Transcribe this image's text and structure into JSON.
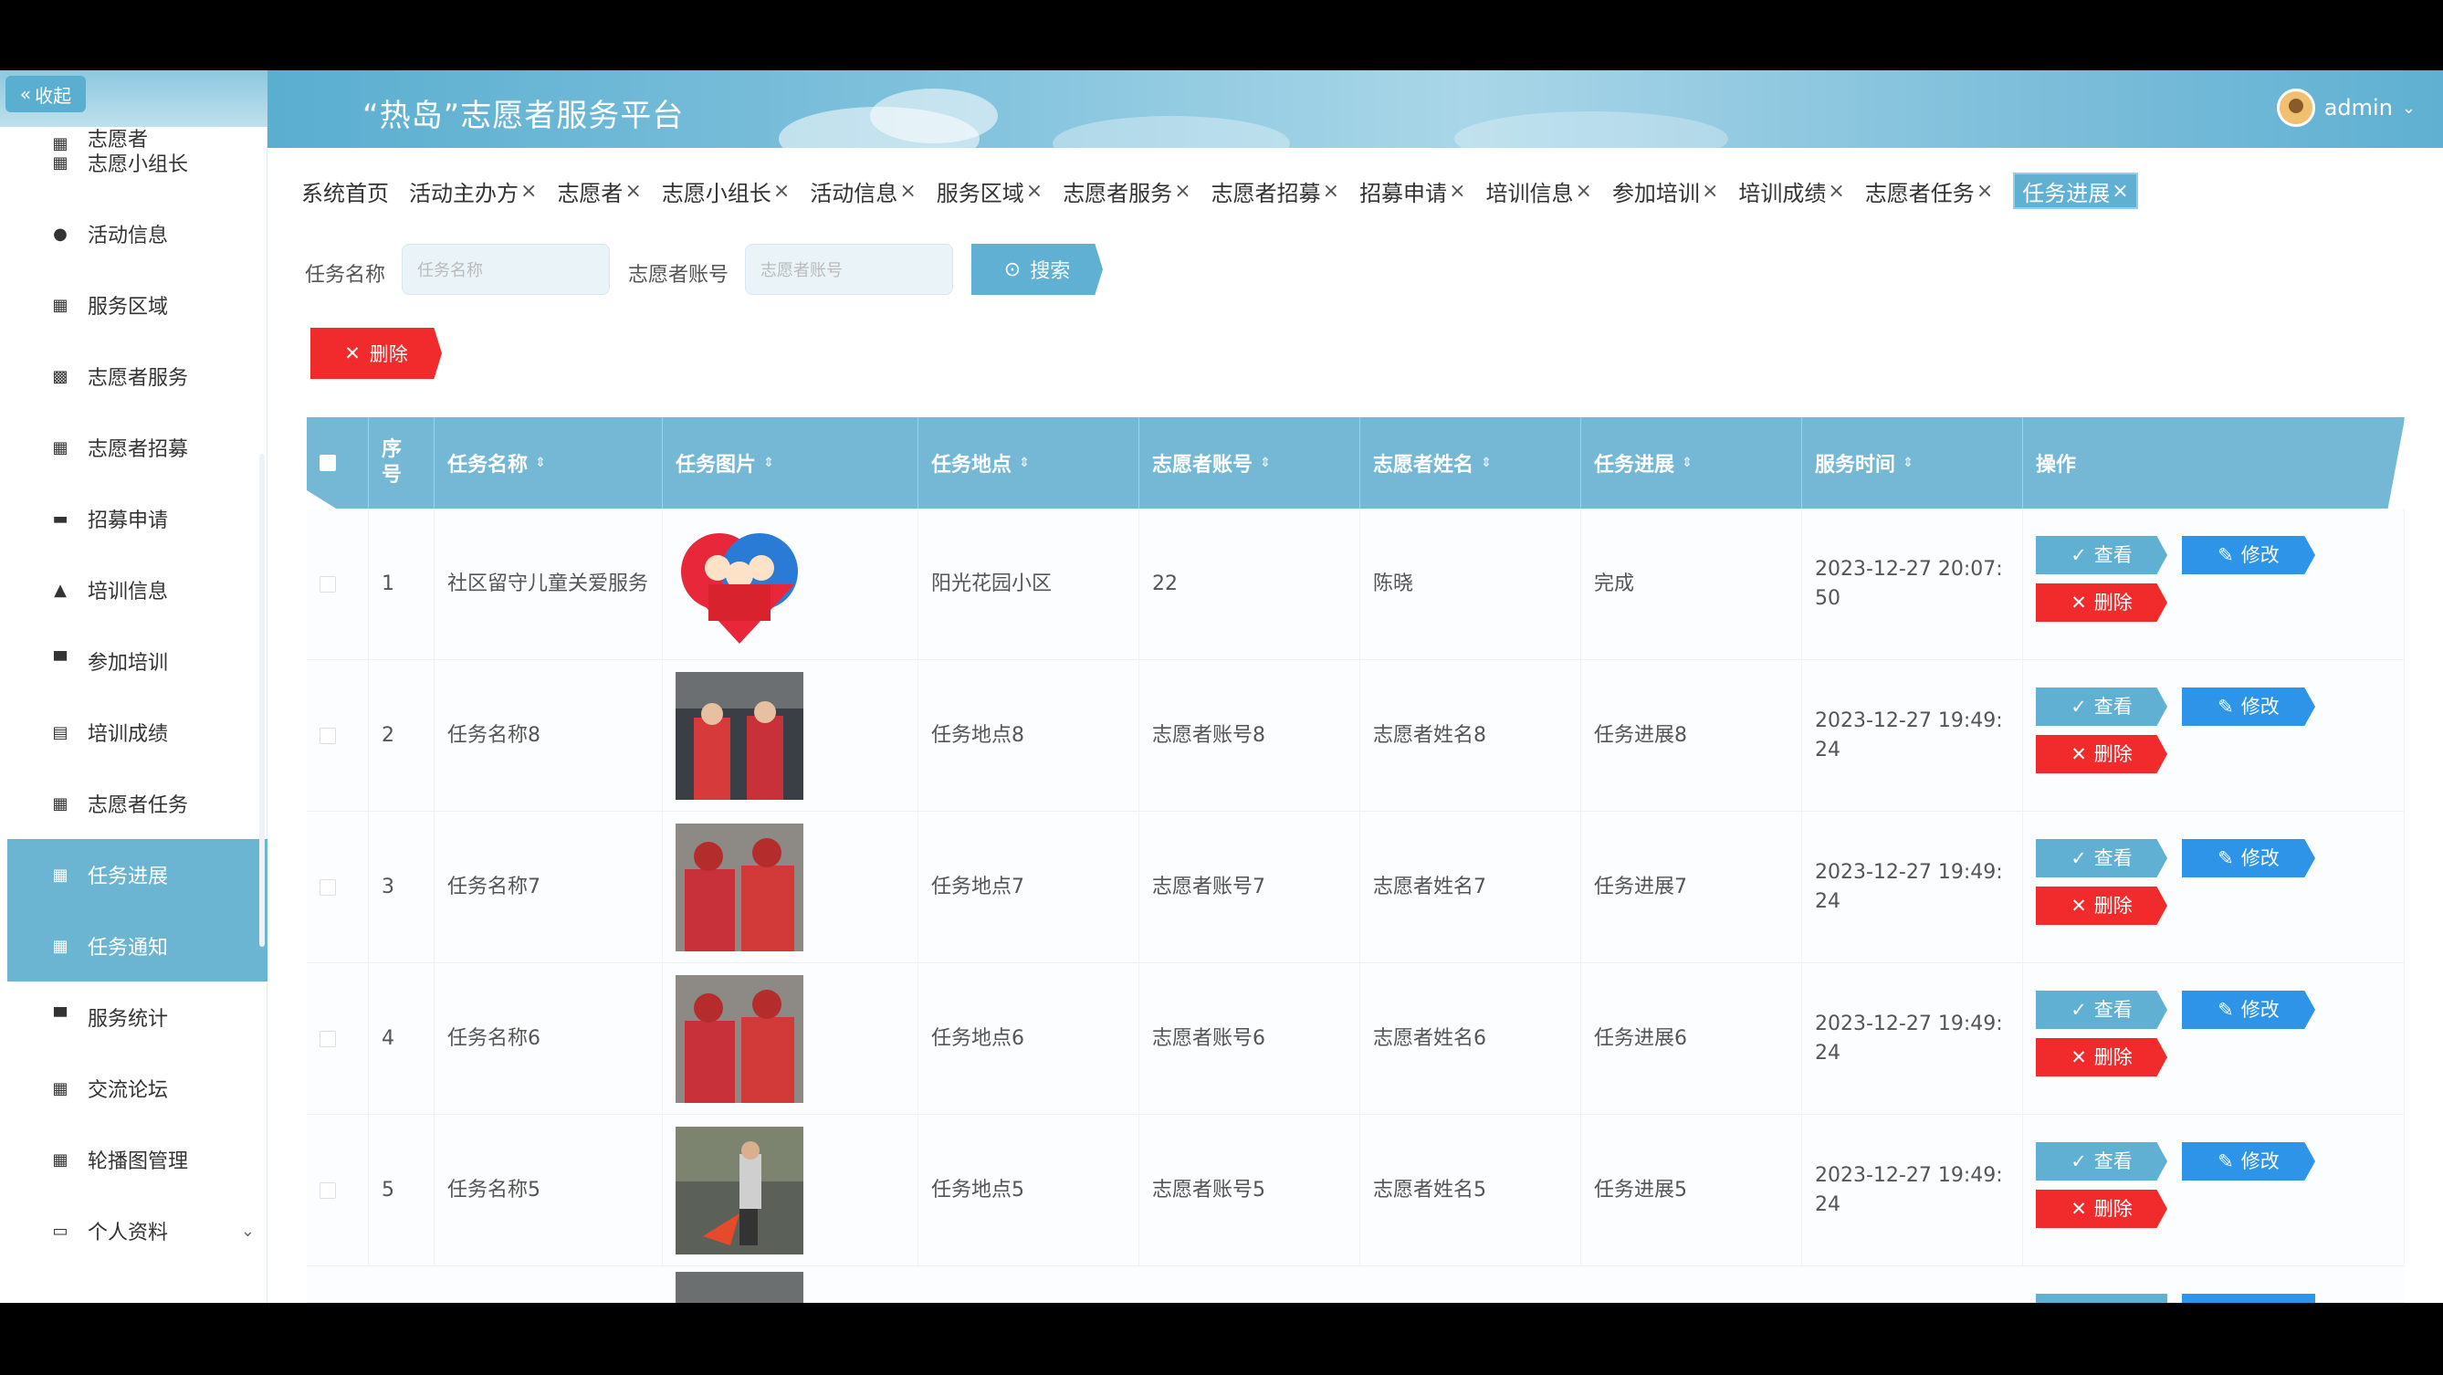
{
  "header": {
    "title": "“热岛”志愿者服务平台",
    "user": "admin"
  },
  "sidebar": {
    "collapse_label": "收起",
    "items": [
      {
        "label": "志愿者",
        "icon": "grid-icon"
      },
      {
        "label": "志愿小组长",
        "icon": "grid-icon"
      },
      {
        "label": "活动信息",
        "icon": "location-pin-icon"
      },
      {
        "label": "服务区域",
        "icon": "grid-icon"
      },
      {
        "label": "志愿者服务",
        "icon": "ticket-icon"
      },
      {
        "label": "志愿者招募",
        "icon": "grid-icon"
      },
      {
        "label": "招募申请",
        "icon": "wallet-icon"
      },
      {
        "label": "培训信息",
        "icon": "user-icon"
      },
      {
        "label": "参加培训",
        "icon": "comment-icon"
      },
      {
        "label": "培训成绩",
        "icon": "document-icon"
      },
      {
        "label": "志愿者任务",
        "icon": "grid-icon"
      },
      {
        "label": "任务进展",
        "icon": "grid-icon"
      },
      {
        "label": "任务通知",
        "icon": "grid-icon"
      },
      {
        "label": "服务统计",
        "icon": "monitor-icon"
      },
      {
        "label": "交流论坛",
        "icon": "grid-icon"
      },
      {
        "label": "轮播图管理",
        "icon": "grid-icon"
      },
      {
        "label": "个人资料",
        "icon": "calendar-icon"
      }
    ]
  },
  "tabs": [
    "系统首页",
    "活动主办方",
    "志愿者",
    "志愿小组长",
    "活动信息",
    "服务区域",
    "志愿者服务",
    "志愿者招募",
    "招募申请",
    "培训信息",
    "参加培训",
    "培训成绩",
    "志愿者任务",
    "任务进展"
  ],
  "tab_close": "×",
  "search": {
    "task_name_label": "任务名称",
    "task_name_placeholder": "任务名称",
    "account_label": "志愿者账号",
    "account_placeholder": "志愿者账号",
    "search_button": "搜索"
  },
  "delete_button": "删除",
  "table": {
    "headers": [
      "序号",
      "任务名称",
      "任务图片",
      "任务地点",
      "志愿者账号",
      "志愿者姓名",
      "任务进展",
      "服务时间",
      "操作"
    ],
    "rows": [
      {
        "idx": "1",
        "name": "社区留守儿童关爱服务",
        "location": "阳光花园小区",
        "account": "22",
        "volunteer": "陈晓",
        "progress": "完成",
        "time": "2023-12-27 20:07:50"
      },
      {
        "idx": "2",
        "name": "任务名称8",
        "location": "任务地点8",
        "account": "志愿者账号8",
        "volunteer": "志愿者姓名8",
        "progress": "任务进展8",
        "time": "2023-12-27 19:49:24"
      },
      {
        "idx": "3",
        "name": "任务名称7",
        "location": "任务地点7",
        "account": "志愿者账号7",
        "volunteer": "志愿者姓名7",
        "progress": "任务进展7",
        "time": "2023-12-27 19:49:24"
      },
      {
        "idx": "4",
        "name": "任务名称6",
        "location": "任务地点6",
        "account": "志愿者账号6",
        "volunteer": "志愿者姓名6",
        "progress": "任务进展6",
        "time": "2023-12-27 19:49:24"
      },
      {
        "idx": "5",
        "name": "任务名称5",
        "location": "任务地点5",
        "account": "志愿者账号5",
        "volunteer": "志愿者姓名5",
        "progress": "任务进展5",
        "time": "2023-12-27 19:49:24"
      }
    ],
    "actions": {
      "view": "查看",
      "edit": "修改",
      "delete": "删除"
    }
  },
  "colors": {
    "accent": "#5fb0d2",
    "danger": "#f12b2b",
    "edit": "#2d94e8"
  }
}
